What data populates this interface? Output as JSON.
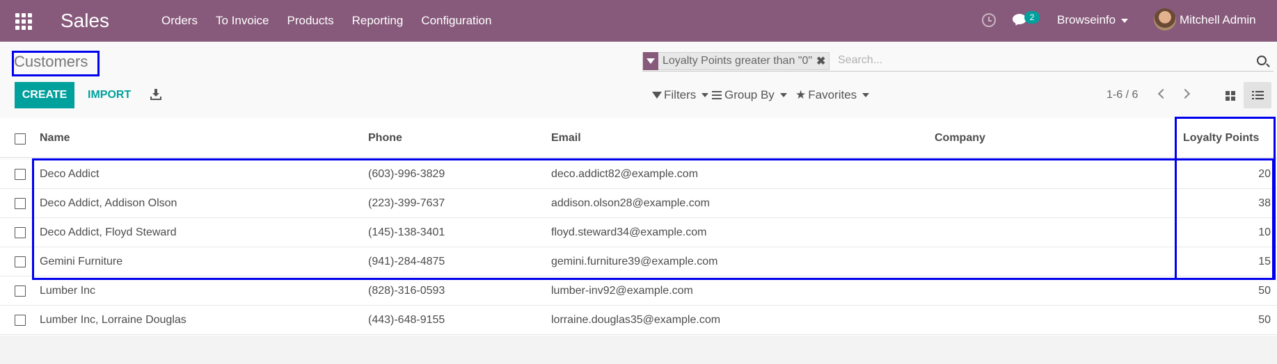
{
  "navbar": {
    "app_name": "Sales",
    "menu": [
      "Orders",
      "To Invoice",
      "Products",
      "Reporting",
      "Configuration"
    ],
    "messages_count": "2",
    "company": "Browseinfo",
    "user": "Mitchell Admin",
    "bg_color": "#875a7b"
  },
  "control_panel": {
    "title": "Customers",
    "facet": "Loyalty Points greater than \"0\"",
    "search_placeholder": "Search...",
    "create_label": "CREATE",
    "import_label": "IMPORT",
    "filters_label": "Filters",
    "groupby_label": "Group By",
    "favorites_label": "Favorites",
    "pager": "1-6 / 6",
    "accent_color": "#00a09d"
  },
  "table": {
    "columns": [
      "Name",
      "Phone",
      "Email",
      "Company",
      "Loyalty Points"
    ],
    "rows": [
      {
        "name": "Deco Addict",
        "phone": "(603)-996-3829",
        "email": "deco.addict82@example.com",
        "company": "",
        "points": "20"
      },
      {
        "name": "Deco Addict, Addison Olson",
        "phone": "(223)-399-7637",
        "email": "addison.olson28@example.com",
        "company": "",
        "points": "38"
      },
      {
        "name": "Deco Addict, Floyd Steward",
        "phone": "(145)-138-3401",
        "email": "floyd.steward34@example.com",
        "company": "",
        "points": "10"
      },
      {
        "name": "Gemini Furniture",
        "phone": "(941)-284-4875",
        "email": "gemini.furniture39@example.com",
        "company": "",
        "points": "15"
      },
      {
        "name": "Lumber Inc",
        "phone": "(828)-316-0593",
        "email": "lumber-inv92@example.com",
        "company": "",
        "points": "50"
      },
      {
        "name": "Lumber Inc, Lorraine Douglas",
        "phone": "(443)-648-9155",
        "email": "lorraine.douglas35@example.com",
        "company": "",
        "points": "50"
      }
    ]
  }
}
